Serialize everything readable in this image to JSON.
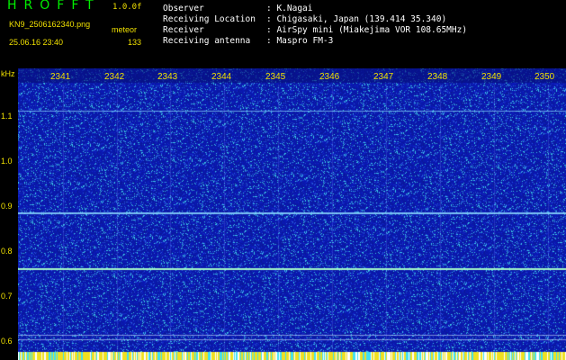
{
  "app": {
    "title": "HROFFT",
    "version": "1.0.0f"
  },
  "file": {
    "name": "KN9_2506162340.png",
    "datetime": "25.06.16 23:40"
  },
  "detection": {
    "label": "meteor",
    "count": "133"
  },
  "metadata": [
    {
      "label": "Observer",
      "value": ": K.Nagai"
    },
    {
      "label": "Receiving Location",
      "value": ": Chigasaki, Japan (139.414 35.340)"
    },
    {
      "label": "Receiver",
      "value": ": AirSpy mini (Miakejima VOR 108.65MHz)"
    },
    {
      "label": "Receiving antenna",
      "value": ": Maspro FM-3"
    }
  ],
  "axis": {
    "y_unit": "kHz",
    "y_ticks": [
      "1.1",
      "1.0",
      "0.9",
      "0.8",
      "0.7",
      "0.6"
    ],
    "x_ticks": [
      "2341",
      "2342",
      "2343",
      "2344",
      "2345",
      "2346",
      "2347",
      "2348",
      "2349",
      "2350"
    ]
  },
  "colors": {
    "label_yellow": "#f0e000",
    "title_green": "#00ee00",
    "background_blue": "#0a1a9e"
  }
}
